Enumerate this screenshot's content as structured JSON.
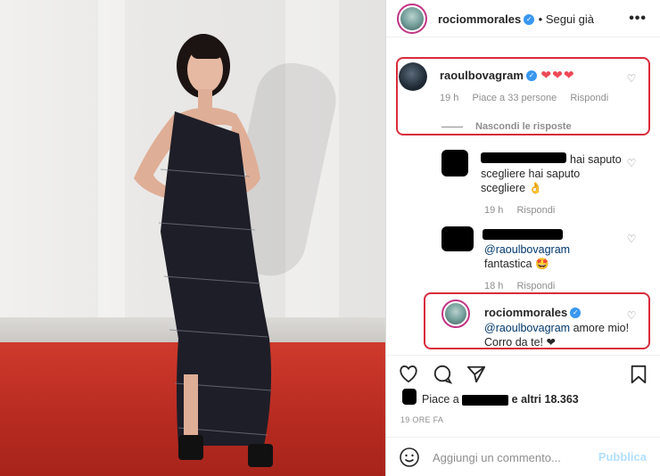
{
  "post": {
    "author": "rociommorales",
    "follow_label": "• Segui già",
    "more_label": "•••"
  },
  "comments": [
    {
      "username": "raoulbovagram",
      "text": "❤❤❤",
      "time": "19 h",
      "likes": "Piace a 33 persone",
      "reply_label": "Rispondi",
      "hide_replies": "Nascondi le risposte"
    }
  ],
  "replies": [
    {
      "text": "hai saputo scegliere hai saputo scegliere 👌",
      "time": "19 h",
      "reply_label": "Rispondi"
    },
    {
      "mention": "@raoulbovagram",
      "text": "fantastica 🤩",
      "time": "18 h",
      "reply_label": "Rispondi"
    },
    {
      "username": "rociommorales",
      "mention": "@raoulbovagram",
      "text": "amore mio! Corro da te! ❤"
    }
  ],
  "likes_bar": {
    "prefix": "Piace a",
    "suffix": "e altri 18.363"
  },
  "timestamp": "19 ORE FA",
  "composer": {
    "placeholder": "Aggiungi un commento...",
    "publish": "Pubblica"
  },
  "colors": {
    "highlight": "#d82c3c",
    "link": "#00376b",
    "verified": "#3897f0"
  }
}
